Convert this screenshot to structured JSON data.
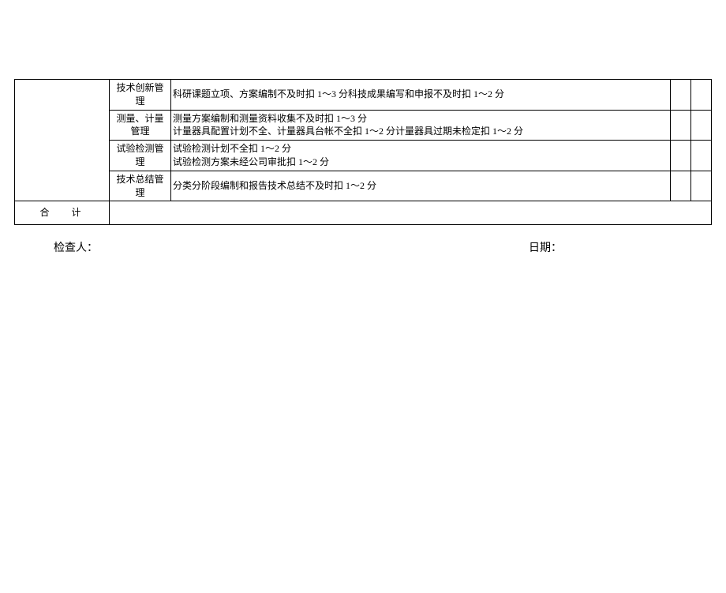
{
  "rows": [
    {
      "label": "技术创新管理",
      "desc": "科研课题立项、方案编制不及时扣 1～3 分科技成果编写和申报不及时扣 1～2 分"
    },
    {
      "label": "测量、计量管理",
      "desc": "测量方案编制和测量资料收集不及时扣 1～3 分\n计量器具配置计划不全、计量器具台帐不全扣 1～2 分计量器具过期未检定扣 1～2 分"
    },
    {
      "label": "试验检测管理",
      "desc": "试验检测计划不全扣 1～2 分\n试验检测方案未经公司审批扣 1～2 分"
    },
    {
      "label": "技术总结管理",
      "desc": "分类分阶段编制和报告技术总结不及时扣 1～2 分"
    }
  ],
  "footer": {
    "total_label": "合计",
    "inspector_label": "检查人：",
    "date_label": "日期："
  }
}
